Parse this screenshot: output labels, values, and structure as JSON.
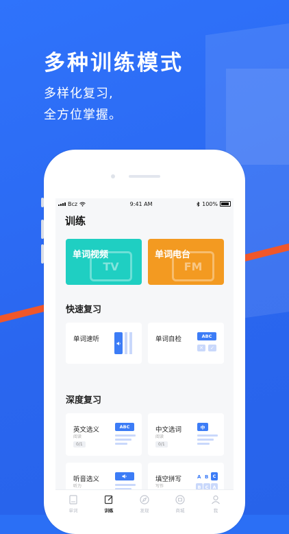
{
  "headline": "多种训练模式",
  "subtitle_line1": "多样化复习,",
  "subtitle_line2": "全方位掌握。",
  "status_bar": {
    "carrier": "Bcz",
    "time": "9:41 AM",
    "battery": "100%"
  },
  "page_title": "训练",
  "features": [
    {
      "label": "单词视频",
      "badge": "TV",
      "color": "#1fcfc2"
    },
    {
      "label": "单词电台",
      "badge": "FM",
      "color": "#f39a21"
    }
  ],
  "quick_review": {
    "title": "快速复习",
    "cards": [
      {
        "title": "单词速听"
      },
      {
        "title": "单词自检",
        "badge": "ABC"
      }
    ]
  },
  "deep_review": {
    "title": "深度复习",
    "cards": [
      {
        "title": "英文选义",
        "subtitle": "阅读",
        "count": "0/1",
        "badge": "ABC"
      },
      {
        "title": "中文选词",
        "subtitle": "阅读",
        "count": "0/1",
        "badge": "中"
      },
      {
        "title": "听音选义",
        "subtitle": "听力"
      },
      {
        "title": "填空拼写",
        "subtitle": "写作",
        "letters": [
          "A",
          "B",
          "C",
          "B",
          "C",
          "A"
        ]
      }
    ]
  },
  "tabbar": [
    {
      "label": "单词",
      "icon": "book-icon"
    },
    {
      "label": "训练",
      "icon": "edit-icon",
      "active": true
    },
    {
      "label": "发现",
      "icon": "compass-icon"
    },
    {
      "label": "商城",
      "icon": "shop-icon"
    },
    {
      "label": "我",
      "icon": "person-icon"
    }
  ],
  "colors": {
    "background": "#2b6ff5",
    "accent": "#3c7cf6",
    "stripe": "#f0572a"
  }
}
